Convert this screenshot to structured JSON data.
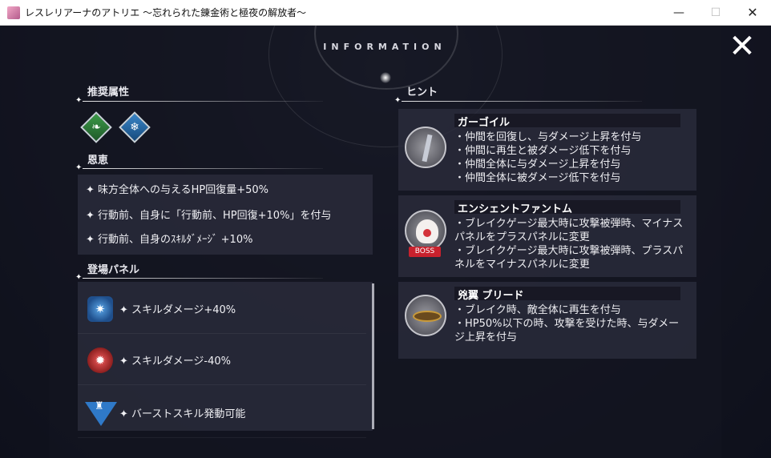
{
  "window": {
    "title": "レスレリアーナのアトリエ ～忘れられた錬金術と極夜の解放者～",
    "minimize_glyph": "—",
    "maximize_glyph": "☐",
    "close_glyph": "✕"
  },
  "header": {
    "title": "INFORMATION",
    "close_glyph": "✕"
  },
  "recommended_attributes": {
    "heading": "推奨属性",
    "icons": [
      {
        "name": "wind-attribute-icon",
        "glyph": "❧",
        "color": "#3c9a48"
      },
      {
        "name": "ice-attribute-icon",
        "glyph": "❄",
        "color": "#3a86c8"
      }
    ]
  },
  "benefits": {
    "heading": "恩恵",
    "items": [
      "✦ 味方全体への与えるHP回復量+50%",
      "✦ 行動前、自身に「行動前、HP回復+10%」を付与",
      "✦ 行動前、自身のｽｷﾙﾀﾞﾒｰｼﾞ +10%"
    ]
  },
  "panels": {
    "heading": "登場パネル",
    "items": [
      {
        "label": "✦ スキルダメージ+40%",
        "icon": "skill-up-icon",
        "glyph": "✷"
      },
      {
        "label": "✦ スキルダメージ-40%",
        "icon": "skill-down-icon",
        "glyph": "✹"
      },
      {
        "label": "✦ バーストスキル発動可能",
        "icon": "burst-skill-icon",
        "glyph": "♜"
      }
    ]
  },
  "hints": {
    "heading": "ヒント",
    "boss_badge": "BOSS",
    "enemies": [
      {
        "name": "ガーゴイル",
        "lines": [
          "・仲間を回復し、与ダメージ上昇を付与",
          "・仲間に再生と被ダメージ低下を付与",
          "・仲間全体に与ダメージ上昇を付与",
          "・仲間全体に被ダメージ低下を付与"
        ]
      },
      {
        "name": "エンシェントファントム",
        "lines": [
          "・ブレイクゲージ最大時に攻撃被弾時、マイナスパネルをプラスパネルに変更",
          "・ブレイクゲージ最大時に攻撃被弾時、プラスパネルをマイナスパネルに変更"
        ]
      },
      {
        "name": "兇翼 ブリード",
        "lines": [
          "・ブレイク時、敵全体に再生を付与",
          "・HP50%以下の時、攻撃を受けた時、与ダメージ上昇を付与"
        ]
      }
    ]
  }
}
